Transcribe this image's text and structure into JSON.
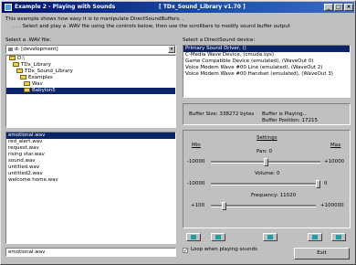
{
  "window": {
    "title": "Example 2 - Playing with Sounds",
    "library": "[ TDx_Sound_Library v1.70 ]"
  },
  "intro": {
    "line1": "This example shows how easy it is to manipulate DirectSoundBuffers. .",
    "line2": ". . . Select and play a .WAV file using the controls below, then use the scrollbars to modify sound buffer output"
  },
  "file_panel": {
    "label": "Select a .WAV file:",
    "drive": "d: [development]",
    "folders": [
      "D:\\",
      "TDx_Library",
      "TDx_Sound_Library",
      "Examples",
      "Wav",
      "Babylon5"
    ],
    "files": [
      "emotional.wav",
      "red_alert.wav",
      "request.wav",
      "rising star.wav",
      "sound.wav",
      "untitled.wav",
      "untitled2.wav",
      "welcome home.wav"
    ],
    "selected_file": "emotional.wav",
    "filename_value": "emotional.wav"
  },
  "device_panel": {
    "label": "Select a DirectSound device:",
    "devices": [
      "Primary Sound Driver, ()",
      "C-Media Wave Device, (cmuda.sys)",
      "Game Compatible Device (emulated), (WaveOut 0)",
      "Voice Modem Wave #00 Line (emulated), (WaveOut 2)",
      "Voice Modem Wave #00 Handset (emulated), (WaveOut 3)"
    ],
    "selected_index": 0
  },
  "buffer_info": {
    "size": "Buffer Size: 338272 bytes",
    "status": "Buffer is Playing...",
    "position": "Buffer Position: 17215"
  },
  "settings": {
    "title": "Settings",
    "min_label": "Min",
    "max_label": "Max",
    "pan_label": "Pan: 0",
    "pan_min": "-10000",
    "pan_max": "+10000",
    "volume_label": "Volume: 0",
    "volume_min": "-10000",
    "volume_max": "0",
    "freq_label": "Frequency: 11020",
    "freq_min": "+100",
    "freq_max": "+100000",
    "pan_level": 0.5,
    "volume_level": 1.0,
    "freq_level": 0.11
  },
  "loop_label": "Loop when playing sounds",
  "exit_label": "Exit",
  "colors": {
    "title_start": "#001070",
    "title_end": "#3a6cc4",
    "selection": "#0a246a",
    "play_icon": "#1aa0a0"
  }
}
